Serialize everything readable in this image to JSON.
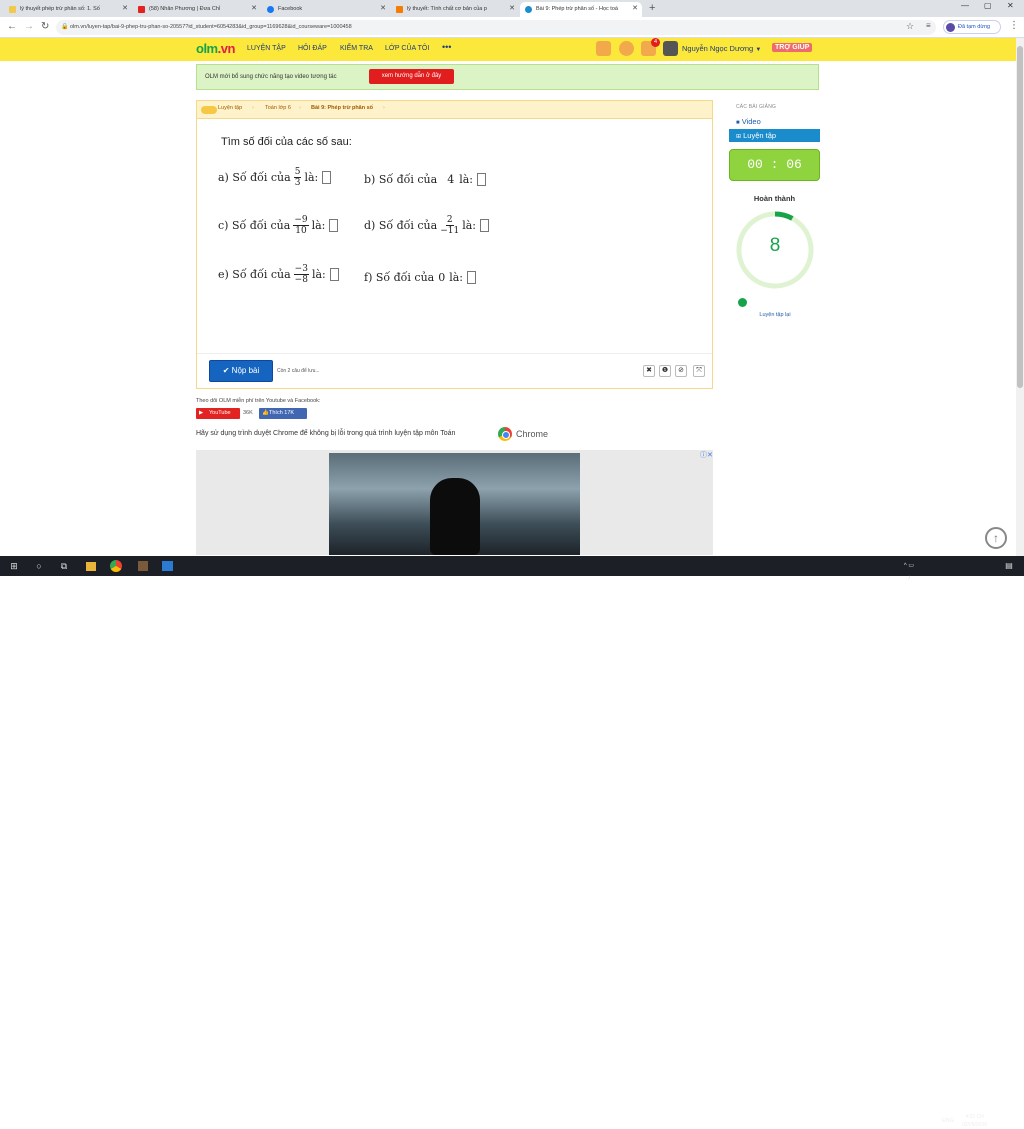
{
  "browser": {
    "tabs": [
      {
        "title": "lý thuyết phép trừ phân số: 1. Số",
        "fav": "#f2c94c"
      },
      {
        "title": "(58) Nhân Phương | Đưa Chỉ",
        "fav": "#e32222"
      },
      {
        "title": "Facebook",
        "fav": "#1877f2"
      },
      {
        "title": "lý thuyết: Tính chất cơ bản của p",
        "fav": "#f57c00"
      },
      {
        "title": "Bài 9: Phép trừ phân số - Học toá",
        "fav": "#1b8ccb"
      }
    ],
    "url": "olm.vn/luyen-tap/bai-9-phep-tru-phan-so-20557?id_student=6054283&id_group=1169628&id_courseware=1000458",
    "profile_label": "Đã tạm dừng"
  },
  "header": {
    "logo_main": "olm",
    "logo_tld": ".vn",
    "nav": [
      "LUYỆN TẬP",
      "HỎI ĐÁP",
      "KIỂM TRA",
      "LỚP CỦA TÔI",
      "•••"
    ],
    "notification_count": "4",
    "username": "Nguyễn Ngọc Dương",
    "help": "TRỢ GIÚP"
  },
  "notice": {
    "text": "OLM mới bổ sung chức năng tạo video tương tác",
    "button": "xem hướng dẫn ở đây"
  },
  "breadcrumbs": [
    "Luyện tập",
    "Toán lớp 6",
    "Bài 9: Phép trừ phân số"
  ],
  "question": {
    "title": "Tìm số đối của các số sau:",
    "a": {
      "pre": "a) Số đối của",
      "num": "5",
      "den": "3",
      "post": "là:"
    },
    "b": {
      "pre": "b) Số đối của",
      "val": "4",
      "post": "là:"
    },
    "c": {
      "pre": "c) Số đối của",
      "num": "−9",
      "den": "10",
      "post": "là:"
    },
    "d": {
      "pre": "d) Số đối của",
      "num": "2",
      "den": "−11",
      "post": "là:"
    },
    "e": {
      "pre": "e) Số đối của",
      "num": "−3",
      "den": "−8",
      "post": "là:"
    },
    "f": {
      "pre": "f) Số đối của",
      "val": "0",
      "post": "là:"
    }
  },
  "footer_bar": {
    "submit": "✔ Nộp bài",
    "remaining": "Còn 2 câu để lưu..."
  },
  "sidebar": {
    "heading": "CÁC BÀI GIẢNG",
    "video": "Video",
    "practice": "Luyện tập",
    "timer": "00 : 06",
    "done_label": "Hoàn thành",
    "score": "8",
    "progress_fraction": 0.08,
    "retry": "Luyện tập lại"
  },
  "social": {
    "follow": "Theo dõi OLM miễn phí trên Youtube và Facebook:",
    "youtube": "YouTube",
    "youtube_count": "36K",
    "facebook": "Thích 17K"
  },
  "chrome_note": "Hãy sử dụng trình duyệt Chrome để không bị lỗi trong quá trình luyện tập môn Toán",
  "chrome_word": "Chrome",
  "taskbar": {
    "lang": "ENG",
    "time": "4:02 CH",
    "date": "02/05/2020"
  }
}
